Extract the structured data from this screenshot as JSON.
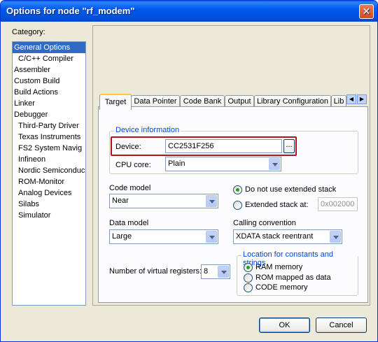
{
  "window": {
    "title": "Options for node \"rf_modem\"",
    "close_label": "✕"
  },
  "category": {
    "label": "Category:",
    "items": [
      {
        "label": "General Options",
        "sub": false,
        "selected": true
      },
      {
        "label": "C/C++ Compiler",
        "sub": true
      },
      {
        "label": "Assembler",
        "sub": false
      },
      {
        "label": "Custom Build",
        "sub": false
      },
      {
        "label": "Build Actions",
        "sub": false
      },
      {
        "label": "Linker",
        "sub": false
      },
      {
        "label": "Debugger",
        "sub": false
      },
      {
        "label": "Third-Party Driver",
        "sub": true
      },
      {
        "label": "Texas Instruments",
        "sub": true
      },
      {
        "label": "FS2 System Navig",
        "sub": true
      },
      {
        "label": "Infineon",
        "sub": true
      },
      {
        "label": "Nordic Semiconduc",
        "sub": true
      },
      {
        "label": "ROM-Monitor",
        "sub": true
      },
      {
        "label": "Analog Devices",
        "sub": true
      },
      {
        "label": "Silabs",
        "sub": true
      },
      {
        "label": "Simulator",
        "sub": true
      }
    ]
  },
  "tabs": [
    "Target",
    "Data Pointer",
    "Code Bank",
    "Output",
    "Library Configuration",
    "Lib"
  ],
  "device_info": {
    "group_title": "Device information",
    "device_label": "Device:",
    "device_value": "CC2531F256",
    "browse_label": "...",
    "cpu_core_label": "CPU core:",
    "cpu_core_value": "Plain"
  },
  "code_model": {
    "label": "Code model",
    "value": "Near"
  },
  "data_model": {
    "label": "Data model",
    "value": "Large"
  },
  "stack": {
    "option_no_ext": "Do not use extended stack",
    "option_ext": "Extended stack at:",
    "ext_address": "0x002000"
  },
  "calling_convention": {
    "label": "Calling convention",
    "value": "XDATA stack reentrant"
  },
  "virtual_registers": {
    "label": "Number of virtual registers:",
    "value": "8"
  },
  "location": {
    "group_title": "Location for constants and strings",
    "options": [
      "RAM memory",
      "ROM mapped as data",
      "CODE memory"
    ]
  },
  "buttons": {
    "ok": "OK",
    "cancel": "Cancel"
  },
  "colors": {
    "highlight_border": "#b5121b",
    "selection": "#316ac5",
    "titlebar": "#0058ee"
  }
}
